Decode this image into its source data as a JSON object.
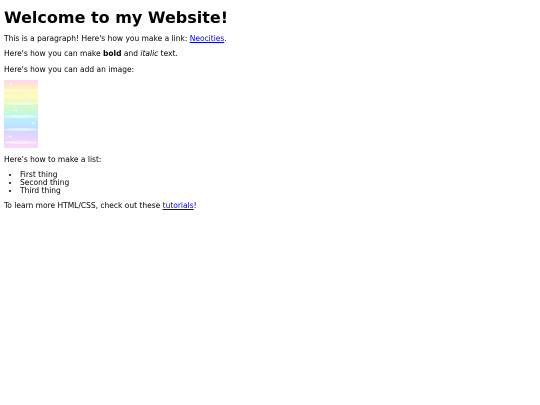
{
  "heading": "Welcome to my Website!",
  "para1": {
    "before": "This is a paragraph! Here's how you make a link: ",
    "link": "Neocities",
    "after": "."
  },
  "para2": {
    "before": "Here's how you can make ",
    "bold": "bold",
    "middle": " and ",
    "italic": "italic",
    "after": " text."
  },
  "para3": "Here's how you can add an image:",
  "image": {
    "icon": "rainbow-pastel-image",
    "colors": [
      "#ffd6f0",
      "#fff4b3",
      "#d9fbc0",
      "#c2f7e6",
      "#b9e9ff",
      "#e8d3ff"
    ]
  },
  "para4": "Here's how to make a list:",
  "list": [
    "First thing",
    "Second thing",
    "Third thing"
  ],
  "para5": {
    "before": "To learn more HTML/CSS, check out these ",
    "link": "tutorials",
    "after": "!"
  },
  "link_color": "#0000ee"
}
